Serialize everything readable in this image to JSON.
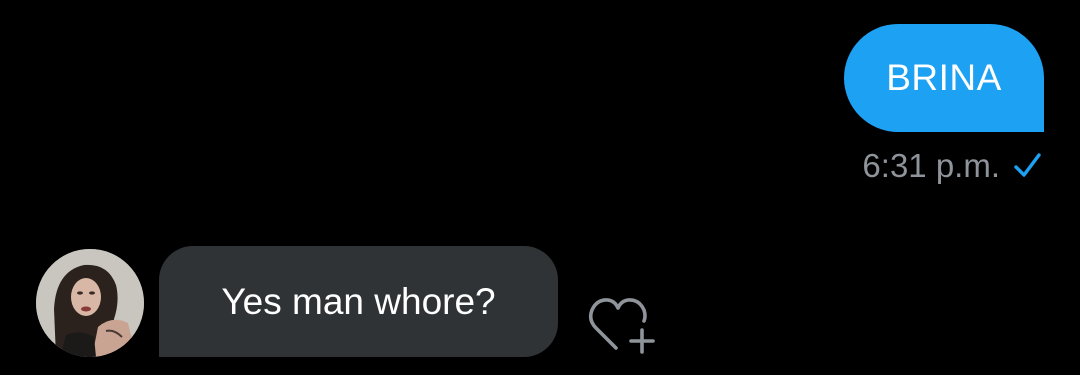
{
  "conversation": {
    "outgoing": {
      "text": "BRINA",
      "time": "6:31 p.m.",
      "status_icon": "check-icon"
    },
    "incoming": {
      "text": "Yes man whore?",
      "avatar_icon": "avatar",
      "reaction_icon": "heart-plus-icon"
    }
  },
  "colors": {
    "background": "#000000",
    "outgoing_bubble": "#1DA1F2",
    "incoming_bubble": "#2F3336",
    "timestamp": "#8E949A",
    "check": "#1DA1F2"
  }
}
